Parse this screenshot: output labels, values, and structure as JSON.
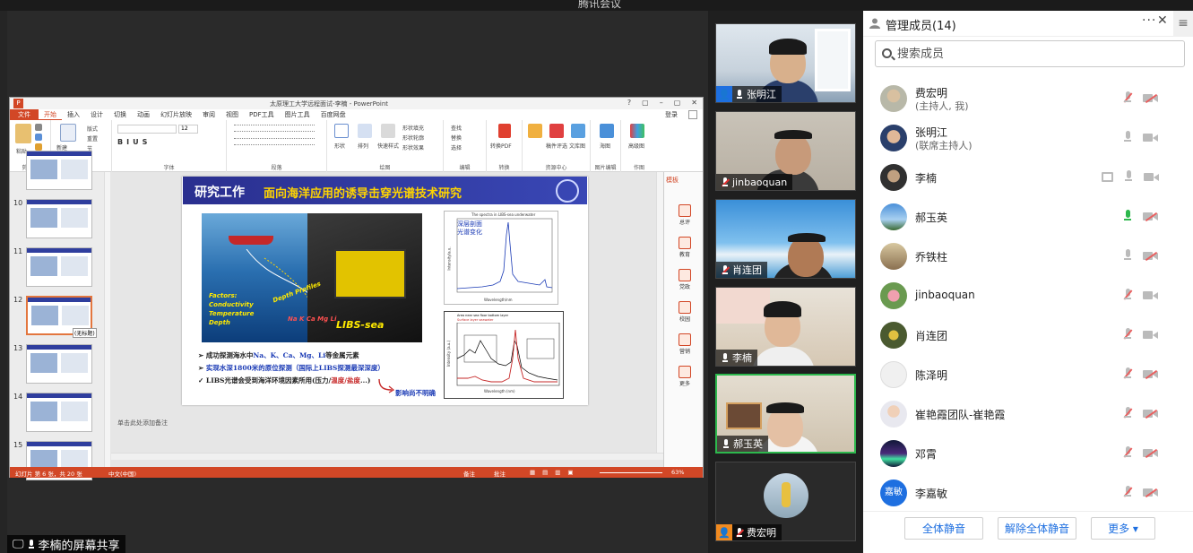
{
  "window": {
    "title": "腾讯会议"
  },
  "share": {
    "label": "李楠的屏幕共享"
  },
  "ppt": {
    "title": "太原理工大学远程面试-李楠 - PowerPoint",
    "window_controls": [
      "?",
      "▢",
      "–",
      "▢",
      "✕"
    ],
    "tabs": [
      "文件",
      "开始",
      "插入",
      "设计",
      "切换",
      "动画",
      "幻灯片放映",
      "审阅",
      "视图",
      "PDF工具",
      "图片工具",
      "百度网盘"
    ],
    "login": "登录",
    "ribbon_groups": [
      "剪贴板",
      "幻灯片",
      "字体",
      "段落",
      "绘图",
      "编辑",
      "转换",
      "资源中心",
      "图片编辑",
      "作图"
    ],
    "ribbon_items": {
      "paste": "粘贴",
      "new_slide": "新建\n幻灯片",
      "layout": "版式",
      "reset": "重置",
      "section": "节",
      "font_size": "12",
      "shape": "形状",
      "arrange": "排列",
      "quick_styles": "快速样式",
      "shape_fill": "形状填充",
      "shape_outline": "形状轮廓",
      "shape_effects": "形状效果",
      "find": "查找",
      "replace": "替换",
      "select": "选择",
      "pdf": "转换PDF",
      "send_pdf": "稿件评选",
      "doc": "文库图",
      "picture": "海图",
      "mind": "高级图"
    },
    "thumbs": [
      {
        "num": "10"
      },
      {
        "num": "11"
      },
      {
        "num": "12"
      },
      {
        "num": "13"
      },
      {
        "num": "14"
      },
      {
        "num": "15"
      }
    ],
    "thumb_tooltip": "(无标题)",
    "slide": {
      "title_main": "研究工作",
      "title_sub": "面向海洋应用的诱导击穿光谱技术研究",
      "photo_labels": {
        "factors": "Factors:",
        "conductivity": "Conductivity",
        "temperature": "Temperature",
        "depth": "Depth",
        "depth_profiles": "Depth Profiles",
        "libs_sea": "LIBS-sea",
        "elements": "Na K Ca Mg Li"
      },
      "chart1": {
        "title": "The spectra in LIBS-sea underwater",
        "label1": "深层剖面",
        "label2": "光谱变化",
        "xlabel": "Wavelength/nm",
        "ylabel": "Intensity/a.u."
      },
      "chart2": {
        "legend1": "Area near sea floor bottom layer",
        "legend2": "Surface layer seawater",
        "xlabel": "Wavelength (nm)",
        "ylabel": "Intensity (a.u.)"
      },
      "bullets": [
        {
          "marker": "➢",
          "pre": "成功探测海水中",
          "hl": "Na、K、Ca、Mg、Li",
          "post": "等金属元素"
        },
        {
          "marker": "➢",
          "pre": "",
          "hl": "实现水深1800米的原位探测（国际上LIBS探测最深深度）",
          "post": ""
        },
        {
          "marker": "✓",
          "pre": "LIBS光谱会受到海洋环境因素所用(压力/",
          "hl": "温度/盐度",
          "post": "...)"
        }
      ],
      "impact": "影响尚不明确"
    },
    "notes_placeholder": "单击此处添加备注",
    "side_panel": {
      "header": "模板",
      "items": [
        "总评",
        "教育",
        "党政",
        "校园",
        "营销",
        "更多"
      ]
    },
    "status": {
      "slide": "幻灯片 第 6 张，共 20 张",
      "lang": "中文(中国)",
      "notes": "备注",
      "comments": "批注",
      "zoom": "63%"
    }
  },
  "videos": [
    {
      "name": "张明江",
      "host": true,
      "muted": false
    },
    {
      "name": "jinbaoquan",
      "host": false,
      "muted": true
    },
    {
      "name": "肖连团",
      "host": false,
      "muted": true
    },
    {
      "name": "李楠",
      "host": false,
      "muted": false
    },
    {
      "name": "郝玉英",
      "host": false,
      "muted": false,
      "active": true
    },
    {
      "name": "费宏明",
      "host": true,
      "muted": true
    }
  ],
  "members": {
    "title": "管理成员(14)",
    "more": "···",
    "search_placeholder": "搜索成员",
    "list": [
      {
        "name": "费宏明",
        "sub": "(主持人, 我)",
        "mic": "muted",
        "cam": "muted",
        "screen": false
      },
      {
        "name": "张明江",
        "sub": "(联席主持人)",
        "mic": "off",
        "cam": "off",
        "screen": false
      },
      {
        "name": "李楠",
        "sub": "",
        "mic": "off",
        "cam": "off",
        "screen": true
      },
      {
        "name": "郝玉英",
        "sub": "",
        "mic": "on",
        "cam": "muted",
        "screen": false
      },
      {
        "name": "乔铁柱",
        "sub": "",
        "mic": "off",
        "cam": "muted",
        "screen": false
      },
      {
        "name": "jinbaoquan",
        "sub": "",
        "mic": "muted",
        "cam": "off",
        "screen": false
      },
      {
        "name": "肖连团",
        "sub": "",
        "mic": "muted",
        "cam": "off",
        "screen": false
      },
      {
        "name": "陈泽明",
        "sub": "",
        "mic": "muted",
        "cam": "muted",
        "screen": false
      },
      {
        "name": "崔艳霞团队-崔艳霞",
        "sub": "",
        "mic": "muted",
        "cam": "muted",
        "screen": false
      },
      {
        "name": "邓霄",
        "sub": "",
        "mic": "muted",
        "cam": "muted",
        "screen": false
      },
      {
        "name": "李嘉敏",
        "sub": "",
        "mic": "muted",
        "cam": "muted",
        "screen": false
      }
    ],
    "avatar_text": "嘉敏",
    "buttons": {
      "mute_all": "全体静音",
      "unmute_all": "解除全体静音",
      "more": "更多 ▾"
    }
  },
  "colors": {
    "ppt_accent": "#d24726",
    "slide_title_bg": "#2a2f8f",
    "slide_title_sub": "#ffd400",
    "active_speaker": "#2db84d",
    "link_blue": "#1e6fe0",
    "mute_red": "#e86060"
  }
}
